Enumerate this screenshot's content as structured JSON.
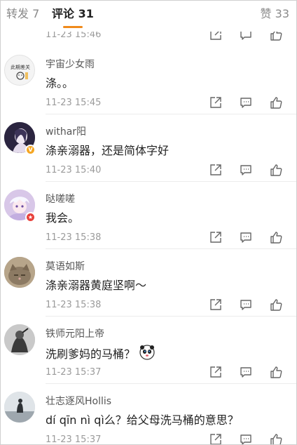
{
  "tabs": {
    "repost_label": "转发 7",
    "comment_label": "评论 31",
    "like_label": "赞 33"
  },
  "partial_comment": {
    "time": "11-23 15:46"
  },
  "comments": [
    {
      "username": "宇宙少女雨",
      "text": "涤。。",
      "time": "11-23 15:45",
      "avatar_text": "此期差关",
      "avatar_bg": "#f4f4f4"
    },
    {
      "username": "withar阳",
      "text": "涤亲溺器，还是简体字好",
      "time": "11-23 15:40",
      "avatar_bg": "#2b2540",
      "badge": "V",
      "badge_color": "#f5a623"
    },
    {
      "username": "哒嗟嗟",
      "text": "我会。",
      "time": "11-23 15:38",
      "avatar_bg": "#d8c7e8",
      "badge": "★",
      "badge_color": "#e8413b"
    },
    {
      "username": "莫语如斯",
      "text": "涤亲溺器黄庭坚啊～",
      "time": "11-23 15:38",
      "avatar_bg": "#8c7a63"
    },
    {
      "username": "铁师元阳上帝",
      "text": "洗刷爹妈的马桶？",
      "time": "11-23 15:37",
      "avatar_bg": "#b9b9b9",
      "emoji": "panda-emoji"
    },
    {
      "username": "壮志逐风Hollis",
      "text": "dí qīn nì qì么？给父母洗马桶的意思？",
      "time": "11-23 15:37",
      "avatar_bg": "#c7cdd3"
    }
  ],
  "colors": {
    "accent": "#f08a1b",
    "time": "#9b9b9b",
    "icon": "#666666"
  }
}
